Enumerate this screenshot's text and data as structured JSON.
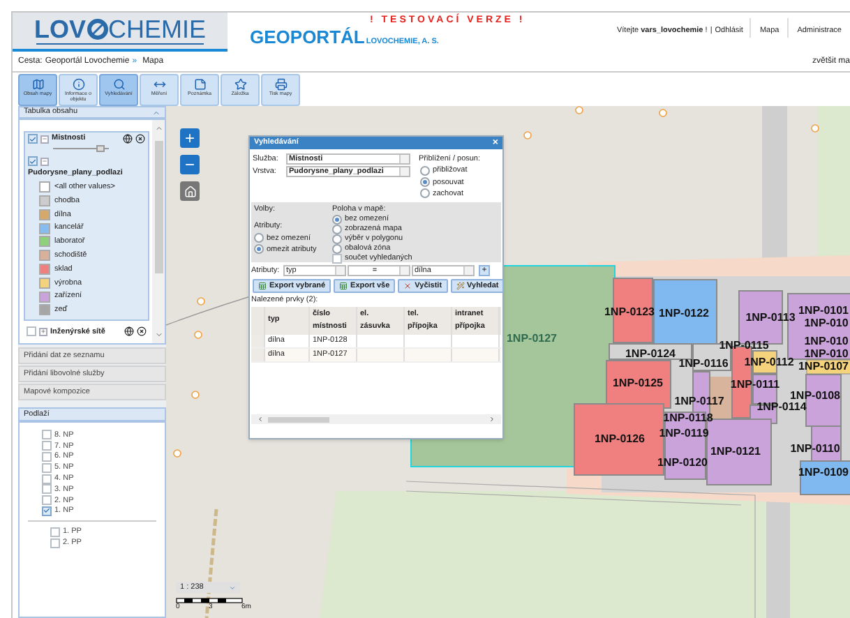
{
  "header": {
    "logo_parts": [
      "LOV",
      "CHEMIE"
    ],
    "title": "GEOPORTÁL",
    "subtitle": "LOVOCHEMIE, A. S.",
    "warning": "! TESTOVACÍ VERZE !",
    "welcome": "Vítejte **vars_lovochemie** !",
    "separator": "|",
    "logout": "Odhlásit",
    "nav": [
      "Mapa",
      "Administrace"
    ]
  },
  "breadcrumb": {
    "label": "Cesta:",
    "items": [
      "Geoportál Lovochemie",
      "Mapa"
    ],
    "separator": "»",
    "zoom_link": "zvětšit ma"
  },
  "toolbar": [
    {
      "label": "Obsah mapy",
      "selected": true
    },
    {
      "label": "Informace o objektu",
      "selected": false
    },
    {
      "label": "Vyhledávání",
      "selected": true
    },
    {
      "label": "Měření",
      "selected": false
    },
    {
      "label": "Poznámka",
      "selected": false
    },
    {
      "label": "Záložka",
      "selected": false
    },
    {
      "label": "Tisk mapy",
      "selected": false
    }
  ],
  "toc": {
    "title": "Tabulka obsahu",
    "layers": [
      {
        "name": "Mistnosti",
        "checked": true,
        "expanded": true,
        "level": 0.9,
        "sublayer": {
          "name": "Pudorysne_plany_podlazi",
          "checked": true,
          "expanded": true
        },
        "legend": [
          {
            "label": "<all other values>",
            "color": "#ffffff"
          },
          {
            "label": "chodba",
            "color": "#cccccc"
          },
          {
            "label": "dílna",
            "color": "#d4a96a"
          },
          {
            "label": "kancelář",
            "color": "#85bdf0"
          },
          {
            "label": "laboratoř",
            "color": "#8fd17a"
          },
          {
            "label": "schodiště",
            "color": "#d9b09a"
          },
          {
            "label": "sklad",
            "color": "#f07f7f"
          },
          {
            "label": "výrobna",
            "color": "#f5d37c"
          },
          {
            "label": "zařízení",
            "color": "#c9a3d9"
          },
          {
            "label": "zeď",
            "color": "#a6a6a6"
          }
        ]
      },
      {
        "name": "Inženýrské sítě",
        "checked": false,
        "expanded": false
      }
    ]
  },
  "sections": [
    "Přidání dat ze seznamu",
    "Přidání libovolné služby",
    "Mapové kompozice"
  ],
  "floors": {
    "title": "Podlaží",
    "groups": [
      [
        {
          "label": "8. NP",
          "checked": false
        },
        {
          "label": "7. NP",
          "checked": false
        },
        {
          "label": "6. NP",
          "checked": false
        },
        {
          "label": "5. NP",
          "checked": false
        },
        {
          "label": "4. NP",
          "checked": false
        },
        {
          "label": "3. NP",
          "checked": false
        },
        {
          "label": "2. NP",
          "checked": false
        },
        {
          "label": "1. NP",
          "checked": true
        }
      ],
      [
        {
          "label": "1. PP",
          "checked": false
        },
        {
          "label": "2. PP",
          "checked": false
        }
      ]
    ]
  },
  "dialog": {
    "title": "Vyhledávání",
    "close": "×",
    "service_label": "Služba:",
    "service": "Mistnosti",
    "layer_label": "Vrstva:",
    "layer": "Pudorysne_plany_podlazi",
    "zoom_title": "Přiblížení / posun:",
    "zoom_options": [
      {
        "label": "přibližovat",
        "selected": false
      },
      {
        "label": "posouvat",
        "selected": true
      },
      {
        "label": "zachovat",
        "selected": false
      }
    ],
    "options_label": "Volby:",
    "attributes_label": "Atributy:",
    "attribute_options": [
      {
        "label": "bez omezení",
        "selected": false
      },
      {
        "label": "omezit atributy",
        "selected": true
      }
    ],
    "location_label": "Poloha v mapě:",
    "location_options": [
      {
        "label": "bez omezení",
        "selected": true
      },
      {
        "label": "zobrazená mapa",
        "selected": false
      },
      {
        "label": "výběr v polygonu",
        "selected": false
      },
      {
        "label": "obalová zóna",
        "selected": false
      }
    ],
    "sum_checkbox": {
      "label": "součet vyhledaných",
      "checked": false
    },
    "filter": {
      "label": "Atributy:",
      "field": "typ",
      "operator": "=",
      "value": "dílna",
      "add": "+"
    },
    "buttons": [
      {
        "label": "Export vybrané",
        "kind": "export"
      },
      {
        "label": "Export vše",
        "kind": "export"
      },
      {
        "label": "Vyčistit",
        "kind": "clear"
      },
      {
        "label": "Vyhledat",
        "kind": "search"
      }
    ],
    "results_label": "Nalezené prvky (2):",
    "columns": [
      "typ",
      "číslo místnosti",
      "el. zásuvka",
      "tel. přípojka",
      "intranet přípojka"
    ],
    "rows": [
      [
        "dílna",
        "1NP-0128"
      ],
      [
        "dílna",
        "1NP-0127"
      ]
    ]
  },
  "map": {
    "rooms": [
      {
        "label": "1NP-0127",
        "color": "#a5c69b"
      },
      {
        "label": "1NP-0123",
        "color": "#f08080"
      },
      {
        "label": "1NP-0122",
        "color": "#80b9ef"
      },
      {
        "label": "1NP-0113",
        "color": "#c9a3d9"
      },
      {
        "label": "1NP-0101",
        "color": "#c9a3d9"
      },
      {
        "label": "1NP-010"
      },
      {
        "label": "1NP-010"
      },
      {
        "label": "1NP-010"
      },
      {
        "label": "1NP-0107"
      },
      {
        "label": "1NP-0124",
        "color": "#d4d4d4"
      },
      {
        "label": "1NP-0116",
        "color": "#d4d4d4"
      },
      {
        "label": "1NP-0115",
        "color": "#f08080"
      },
      {
        "label": "1NP-0112",
        "color": "#f5d37c"
      },
      {
        "label": "1NP-0125",
        "color": "#f08080"
      },
      {
        "label": "1NP-0111",
        "color": "#c9a3d9"
      },
      {
        "label": "1NP-0117",
        "color": "#c9a3d9"
      },
      {
        "label": "1NP-0114",
        "color": "#c9a3d9"
      },
      {
        "label": "1NP-0108",
        "color": "#c9a3d9"
      },
      {
        "label": "1NP-0126",
        "color": "#f08080"
      },
      {
        "label": "1NP-0118"
      },
      {
        "label": "1NP-0119"
      },
      {
        "label": "1NP-0120",
        "color": "#c9a3d9"
      },
      {
        "label": "1NP-0121",
        "color": "#c9a3d9"
      },
      {
        "label": "1NP-0110",
        "color": "#c9a3d9"
      },
      {
        "label": "1NP-0109",
        "color": "#80b9ef"
      }
    ],
    "zoom_in": "+",
    "zoom_out": "−",
    "scale": "1 : 238",
    "scale_ticks": [
      "0",
      "3",
      "6m"
    ]
  }
}
